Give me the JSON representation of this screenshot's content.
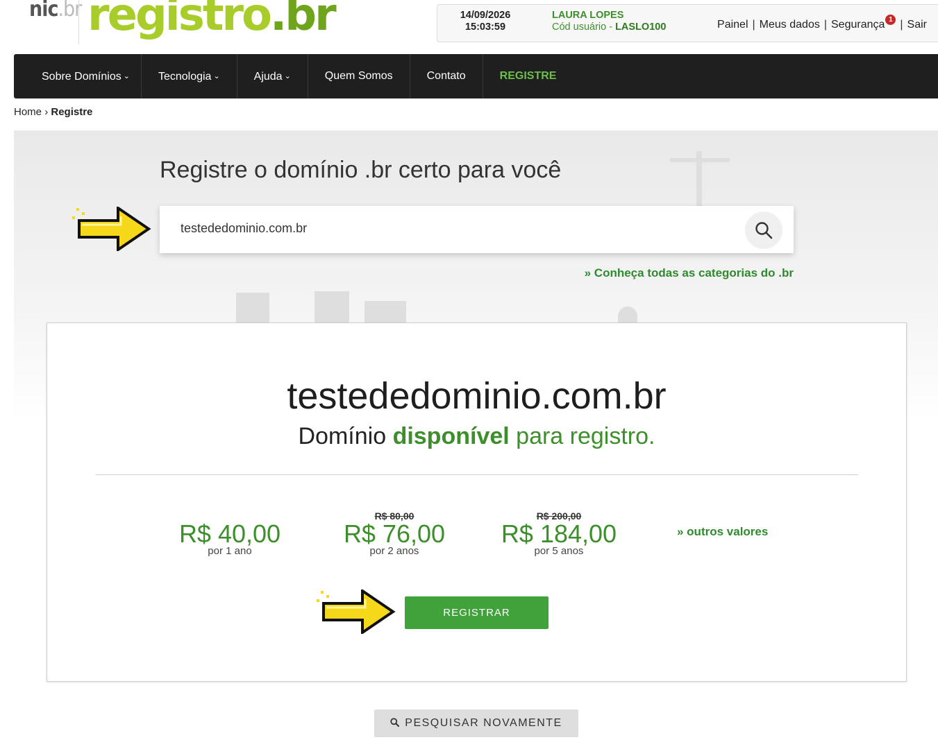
{
  "logo": {
    "nic": "nic",
    "nic_suffix": ".br",
    "registro": "registro",
    "registro_suffix": ".br"
  },
  "user": {
    "date": "14/09/2026",
    "time": "15:03:59",
    "name": "LAURA LOPES",
    "code_label": "Cód usuário - ",
    "code": "LASLO100",
    "links": {
      "painel": "Painel",
      "meus_dados": "Meus dados",
      "seguranca": "Segurança",
      "seguranca_badge": "1",
      "sair": "Sair"
    },
    "separator": "|"
  },
  "nav": {
    "items": [
      {
        "label": "Sobre Domínios",
        "dropdown": true
      },
      {
        "label": "Tecnologia",
        "dropdown": true
      },
      {
        "label": "Ajuda",
        "dropdown": true
      },
      {
        "label": "Quem Somos",
        "dropdown": false
      },
      {
        "label": "Contato",
        "dropdown": false
      },
      {
        "label": "REGISTRE",
        "dropdown": false,
        "active": true
      }
    ],
    "chevron": "⌵"
  },
  "breadcrumb": {
    "home": "Home",
    "separator": "›",
    "current": "Registre"
  },
  "hero": {
    "title": "Registre o domínio .br certo para você",
    "search_value": "testededominio.com.br",
    "categories_link": "» Conheça todas as categorias do .br"
  },
  "result": {
    "domain": "testededominio.com.br",
    "availability_prefix": "Domínio",
    "availability_status": "disponível",
    "availability_suffix": "para registro.",
    "prices": [
      {
        "old": "",
        "value": "R$ 40,00",
        "period": "por 1 ano"
      },
      {
        "old": "R$ 80,00",
        "value": "R$ 76,00",
        "period": "por 2 anos"
      },
      {
        "old": "R$ 200,00",
        "value": "R$ 184,00",
        "period": "por 5 anos"
      }
    ],
    "other_values": "» outros valores",
    "register_button": "REGISTRAR"
  },
  "search_again": "PESQUISAR NOVAMENTE",
  "colors": {
    "brand_green": "#3d8f2b",
    "button_green": "#3fa23a",
    "logo_green": "#a8cd2a",
    "nav_bg": "#1f1f1f",
    "badge_red": "#c62828",
    "arrow_yellow": "#f6d81b"
  },
  "icons": {
    "search": "search-icon",
    "arrow": "pointer-arrow-icon",
    "chevron": "chevron-down-icon"
  }
}
